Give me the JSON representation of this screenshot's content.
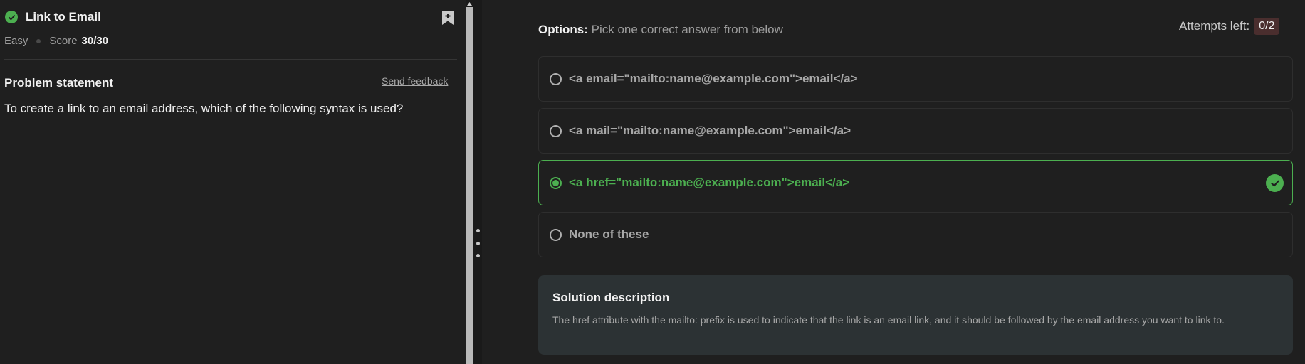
{
  "problem": {
    "title": "Link to Email",
    "difficulty": "Easy",
    "score_label": "Score",
    "score_value": "30/30",
    "statement_heading": "Problem statement",
    "feedback_link": "Send feedback",
    "statement_text": "To create a link to an email address, which of the following syntax is used?"
  },
  "quiz": {
    "options_label": "Options:",
    "options_hint": "Pick one correct answer from below",
    "attempts_label": "Attempts left:",
    "attempts_value": "0/2",
    "options": [
      {
        "label": "<a email=\"mailto:name@example.com\">email</a>",
        "selected": false,
        "correct": false
      },
      {
        "label": "<a mail=\"mailto:name@example.com\">email</a>",
        "selected": false,
        "correct": false
      },
      {
        "label": "<a href=\"mailto:name@example.com\">email</a>",
        "selected": true,
        "correct": true
      },
      {
        "label": "None of these",
        "selected": false,
        "correct": false
      }
    ]
  },
  "solution": {
    "heading": "Solution description",
    "text": "The href attribute with the mailto: prefix is used to indicate that the link is an email link, and it should be followed by the email address you want to link to."
  },
  "colors": {
    "accent_green": "#4caf50",
    "background": "#1f1f1f",
    "solution_bg": "#2c3234",
    "attempts_badge_bg": "#4a2e2e"
  },
  "icons": {
    "solved": "check-circle-icon",
    "bookmark": "bookmark-add-icon",
    "correct": "check-circle-icon",
    "resize": "vertical-grip-icon"
  }
}
